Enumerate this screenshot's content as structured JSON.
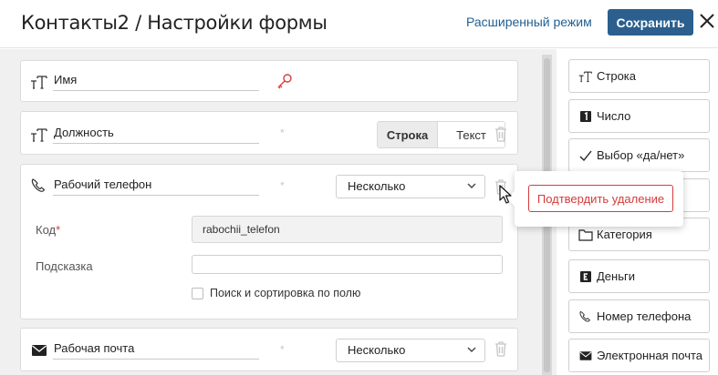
{
  "header": {
    "title": "Контакты2 / Настройки формы",
    "advanced_mode_label": "Расширенный режим",
    "save_label": "Сохранить"
  },
  "fields": [
    {
      "name": "Имя",
      "icon": "text-type-icon",
      "required_mark": ""
    },
    {
      "name": "Должность",
      "icon": "text-type-icon",
      "required_mark": "*",
      "segment": {
        "active": "Строка",
        "inactive": "Текст"
      }
    },
    {
      "name": "Рабочий телефон",
      "icon": "phone-icon",
      "required_mark": "*",
      "select_value": "Несколько",
      "details": {
        "code_label": "Код",
        "code_required": "*",
        "code_value": "rabochii_telefon",
        "hint_label": "Подсказка",
        "hint_value": "",
        "search_checkbox_label": "Поиск и сортировка по полю"
      }
    },
    {
      "name": "Рабочая почта",
      "icon": "envelope-icon",
      "required_mark": "*",
      "select_value": "Несколько"
    }
  ],
  "confirm_delete_label": "Подтвердить удаление",
  "palette": [
    {
      "label": "Строка",
      "icon": "text-type-icon"
    },
    {
      "label": "Число",
      "icon": "number-icon"
    },
    {
      "label": "Выбор «да/нет»",
      "icon": "check-icon"
    },
    {
      "label": "",
      "icon": ""
    },
    {
      "label": "Категория",
      "icon": "folder-icon"
    },
    {
      "label": "Деньги",
      "icon": "money-icon"
    },
    {
      "label": "Номер телефона",
      "icon": "phone-icon"
    },
    {
      "label": "Электронная почта",
      "icon": "envelope-icon"
    }
  ],
  "colors": {
    "accent": "#2b5f8e",
    "link": "#1f5f93",
    "danger": "#d63b3b"
  }
}
